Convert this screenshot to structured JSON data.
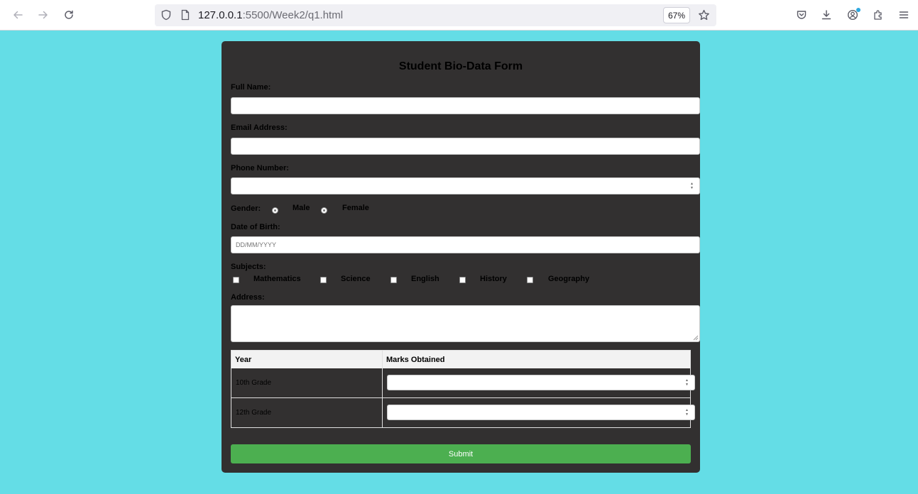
{
  "browser": {
    "url_host": "127.0.0.1",
    "url_path": ":5500/Week2/q1.html",
    "zoom": "67%"
  },
  "form": {
    "title": "Student Bio-Data Form",
    "full_name_label": "Full Name:",
    "email_label": "Email Address:",
    "phone_label": "Phone Number:",
    "gender_label": "Gender:",
    "gender_options": [
      "Male",
      "Female"
    ],
    "dob_label": "Date of Birth:",
    "dob_placeholder": "DD/MM/YYYY",
    "subjects_label": "Subjects:",
    "subjects": [
      "Mathematics",
      "Science",
      "English",
      "History",
      "Geography"
    ],
    "address_label": "Address:",
    "table": {
      "headers": [
        "Year",
        "Marks Obtained"
      ],
      "rows": [
        "10th Grade",
        "12th Grade"
      ]
    },
    "submit_label": "Submit"
  }
}
